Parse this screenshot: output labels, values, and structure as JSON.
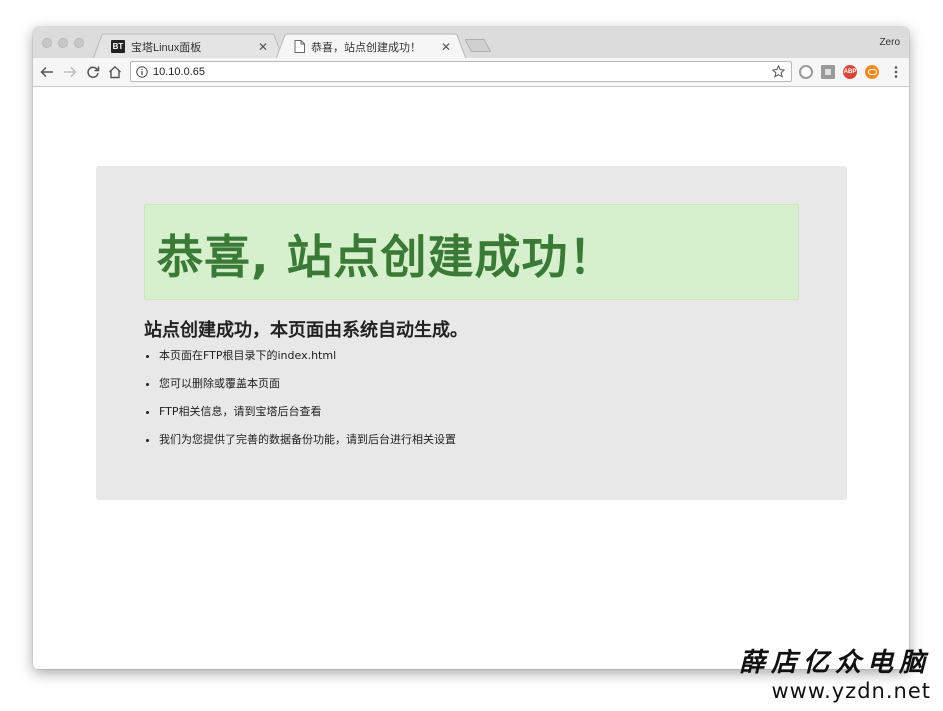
{
  "browser": {
    "profile_name": "Zero",
    "tabs": [
      {
        "title": "宝塔Linux面板",
        "favicon": "BT",
        "active": false
      },
      {
        "title": "恭喜，站点创建成功！",
        "favicon": "page-icon",
        "active": true
      }
    ],
    "address_bar": {
      "url": "10.10.0.65"
    },
    "extensions": [
      {
        "name": "circle-extension-icon",
        "color": "#9a9a9a"
      },
      {
        "name": "screenshot-extension-icon",
        "color": "#8a8a8a"
      },
      {
        "name": "adblock-plus-icon",
        "label": "ABP",
        "color": "#d9463b"
      },
      {
        "name": "orange-extension-icon",
        "color": "#f08a24"
      }
    ]
  },
  "page": {
    "alert_title": "恭喜, 站点创建成功！",
    "subheading": "站点创建成功，本页面由系统自动生成。",
    "items": [
      "本页面在FTP根目录下的index.html",
      "您可以删除或覆盖本页面",
      "FTP相关信息，请到宝塔后台查看",
      "我们为您提供了完善的数据备份功能，请到后台进行相关设置"
    ],
    "colors": {
      "alert_bg": "#d6efcd",
      "alert_text": "#3a7a36",
      "container_bg": "#e8e8e8"
    }
  },
  "watermark": {
    "name": "薛店亿众电脑",
    "url": "www.yzdn.net"
  }
}
